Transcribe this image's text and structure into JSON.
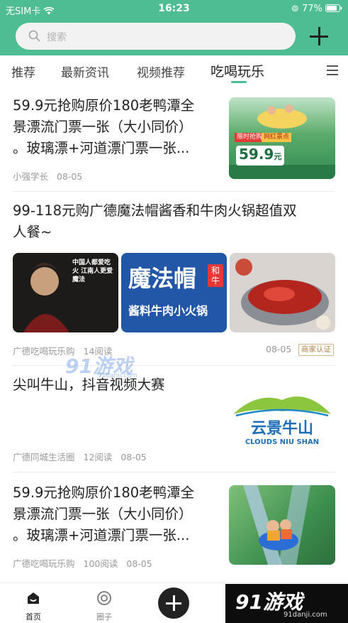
{
  "status_bar": {
    "carrier": "无SIM卡",
    "time": "16:23",
    "battery": "77%"
  },
  "search": {
    "placeholder": "搜索"
  },
  "tabs": [
    {
      "label": "推荐"
    },
    {
      "label": "最新资讯"
    },
    {
      "label": "视频推荐"
    },
    {
      "label": "吃喝玩乐",
      "active": true
    }
  ],
  "articles": [
    {
      "title_lines": [
        "59.9元抢购原价180老鸭潭全",
        "景漂流门票一张（大小同价）",
        "。玻璃漂+河道漂门票一张..."
      ],
      "author": "小强学长",
      "date": "08-05",
      "thumb_text": {
        "tag1": "限时抢购",
        "tag2": "网红景点",
        "price": "59.9",
        "unit": "元"
      }
    },
    {
      "title_lines": [
        "99-118元购广德魔法帽酱香和牛肉火锅超值双",
        "人餐~"
      ],
      "author": "广德吃喝玩乐购",
      "reads": "14阅读",
      "date": "08-05",
      "badge": "商家认证",
      "img1_text": "中国人都爱吃火 江南人更爱魔法",
      "img2_text": {
        "line1": "魔法帽",
        "side": "和牛",
        "line2": "酱料牛肉小火锅"
      }
    },
    {
      "title_lines": [
        "尖叫牛山，抖音视频大赛"
      ],
      "author": "广德同城生活圈",
      "reads": "12阅读",
      "date": "08-05",
      "logo": {
        "cn": "云景牛山",
        "en": "CLOUDS NIU SHAN"
      }
    },
    {
      "title_lines": [
        "59.9元抢购原价180老鸭潭全",
        "景漂流门票一张（大小同价）",
        "。玻璃漂+河道漂门票一张..."
      ],
      "author": "广德吃喝玩乐购",
      "reads": "100阅读",
      "date": "08-05"
    }
  ],
  "watermark_mid": {
    "text": "91游戏",
    "url": "91danji.com"
  },
  "bottom_nav": [
    {
      "label": "首页",
      "active": true
    },
    {
      "label": "圈子"
    }
  ],
  "watermark_br": {
    "text": "91游戏",
    "url": "91danji.com"
  },
  "colors": {
    "accent": "#4ebd93"
  }
}
